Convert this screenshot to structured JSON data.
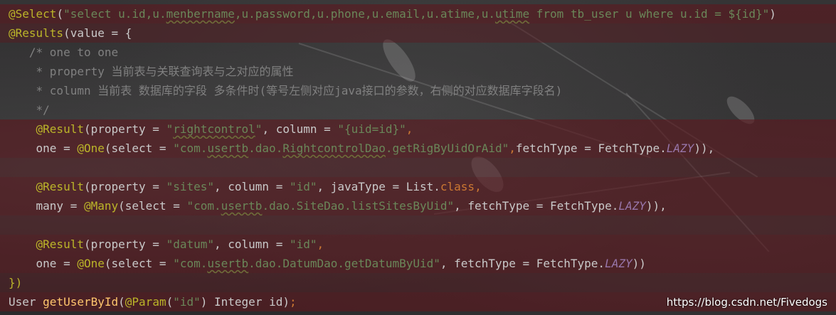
{
  "editor": {
    "lines": [
      {
        "tokens": [
          {
            "t": "@Select",
            "c": "ann"
          },
          {
            "t": "(",
            "c": "txt"
          },
          {
            "t": "\"select u.id,u.",
            "c": "str"
          },
          {
            "t": "menbername",
            "c": "str sq"
          },
          {
            "t": ",u.password,u.phone,u.email,u.atime,u.",
            "c": "str"
          },
          {
            "t": "utime",
            "c": "str sq"
          },
          {
            "t": " from tb_user u where u.id = ${id}\"",
            "c": "str"
          },
          {
            "t": ")",
            "c": "txt"
          }
        ]
      },
      {
        "tokens": [
          {
            "t": "@Results",
            "c": "ann"
          },
          {
            "t": "(value = {",
            "c": "txt"
          }
        ]
      },
      {
        "tokens": [
          {
            "t": "   /* one to one",
            "c": "cmt"
          }
        ]
      },
      {
        "tokens": [
          {
            "t": "    * property 当前表与关联查询表与之对应的属性",
            "c": "cmt"
          }
        ]
      },
      {
        "tokens": [
          {
            "t": "    * column 当前表 数据库的字段 多条件时(等号左侧对应java接口的参数，右侧的对应数据库字段名)",
            "c": "cmt"
          }
        ]
      },
      {
        "tokens": [
          {
            "t": "    */",
            "c": "cmt"
          }
        ]
      },
      {
        "tokens": [
          {
            "t": "    ",
            "c": "txt"
          },
          {
            "t": "@Result",
            "c": "ann"
          },
          {
            "t": "(property = ",
            "c": "txt"
          },
          {
            "t": "\"",
            "c": "str"
          },
          {
            "t": "rightcontrol",
            "c": "str sq"
          },
          {
            "t": "\"",
            "c": "str"
          },
          {
            "t": ", column = ",
            "c": "txt"
          },
          {
            "t": "\"{uid=id}\"",
            "c": "str"
          },
          {
            "t": ",",
            "c": "kw"
          }
        ]
      },
      {
        "tokens": [
          {
            "t": "    one = ",
            "c": "txt"
          },
          {
            "t": "@One",
            "c": "ann"
          },
          {
            "t": "(select = ",
            "c": "txt"
          },
          {
            "t": "\"com.",
            "c": "str"
          },
          {
            "t": "usertb",
            "c": "str sq"
          },
          {
            "t": ".dao.",
            "c": "str"
          },
          {
            "t": "RightcontrolDao",
            "c": "str sq"
          },
          {
            "t": ".getRigByUidOrAid\"",
            "c": "str"
          },
          {
            "t": ",",
            "c": "kw"
          },
          {
            "t": "fetchType = FetchType.",
            "c": "txt"
          },
          {
            "t": "LAZY",
            "c": "fld"
          },
          {
            "t": ")),",
            "c": "txt"
          }
        ]
      },
      {
        "tokens": [
          {
            "t": "",
            "c": "txt"
          }
        ]
      },
      {
        "tokens": [
          {
            "t": "    ",
            "c": "txt"
          },
          {
            "t": "@Result",
            "c": "ann"
          },
          {
            "t": "(property = ",
            "c": "txt"
          },
          {
            "t": "\"sites\"",
            "c": "str"
          },
          {
            "t": ", column = ",
            "c": "txt"
          },
          {
            "t": "\"id\"",
            "c": "str"
          },
          {
            "t": ", javaType = List.",
            "c": "txt"
          },
          {
            "t": "class",
            "c": "kw"
          },
          {
            "t": ",",
            "c": "kw"
          }
        ]
      },
      {
        "tokens": [
          {
            "t": "    many = ",
            "c": "txt"
          },
          {
            "t": "@Many",
            "c": "ann"
          },
          {
            "t": "(select = ",
            "c": "txt"
          },
          {
            "t": "\"com.",
            "c": "str"
          },
          {
            "t": "usertb",
            "c": "str sq"
          },
          {
            "t": ".dao.SiteDao.listSitesByUid\"",
            "c": "str"
          },
          {
            "t": ", fetchType = FetchType.",
            "c": "txt"
          },
          {
            "t": "LAZY",
            "c": "fld"
          },
          {
            "t": ")),",
            "c": "txt"
          }
        ]
      },
      {
        "tokens": [
          {
            "t": "",
            "c": "txt"
          }
        ]
      },
      {
        "tokens": [
          {
            "t": "    ",
            "c": "txt"
          },
          {
            "t": "@Result",
            "c": "ann"
          },
          {
            "t": "(property = ",
            "c": "txt"
          },
          {
            "t": "\"datum\"",
            "c": "str"
          },
          {
            "t": ", column = ",
            "c": "txt"
          },
          {
            "t": "\"id\"",
            "c": "str"
          },
          {
            "t": ",",
            "c": "kw"
          }
        ]
      },
      {
        "tokens": [
          {
            "t": "    one = ",
            "c": "txt"
          },
          {
            "t": "@One",
            "c": "ann"
          },
          {
            "t": "(select = ",
            "c": "txt"
          },
          {
            "t": "\"com.",
            "c": "str"
          },
          {
            "t": "usertb",
            "c": "str sq"
          },
          {
            "t": ".dao.DatumDao.getDatumByUid\"",
            "c": "str"
          },
          {
            "t": ", fetchType = FetchType.",
            "c": "txt"
          },
          {
            "t": "LAZY",
            "c": "fld"
          },
          {
            "t": "))",
            "c": "txt"
          }
        ]
      },
      {
        "tokens": [
          {
            "t": "})",
            "c": "ann"
          }
        ]
      },
      {
        "tokens": [
          {
            "t": "User ",
            "c": "txt"
          },
          {
            "t": "getUserById",
            "c": "mth"
          },
          {
            "t": "(",
            "c": "txt"
          },
          {
            "t": "@Param",
            "c": "ann"
          },
          {
            "t": "(",
            "c": "txt"
          },
          {
            "t": "\"id\"",
            "c": "str"
          },
          {
            "t": ") Integer id)",
            "c": "txt"
          },
          {
            "t": ";",
            "c": "kw"
          }
        ]
      }
    ],
    "highlight": [
      "hl",
      "hl-soft",
      "",
      "",
      "",
      "",
      "hl",
      "hl",
      "hl-soft",
      "hl",
      "hl",
      "hl-soft",
      "hl",
      "hl",
      "hl-soft",
      "hl"
    ]
  },
  "watermark": "https://blog.csdn.net/Fivedogs"
}
